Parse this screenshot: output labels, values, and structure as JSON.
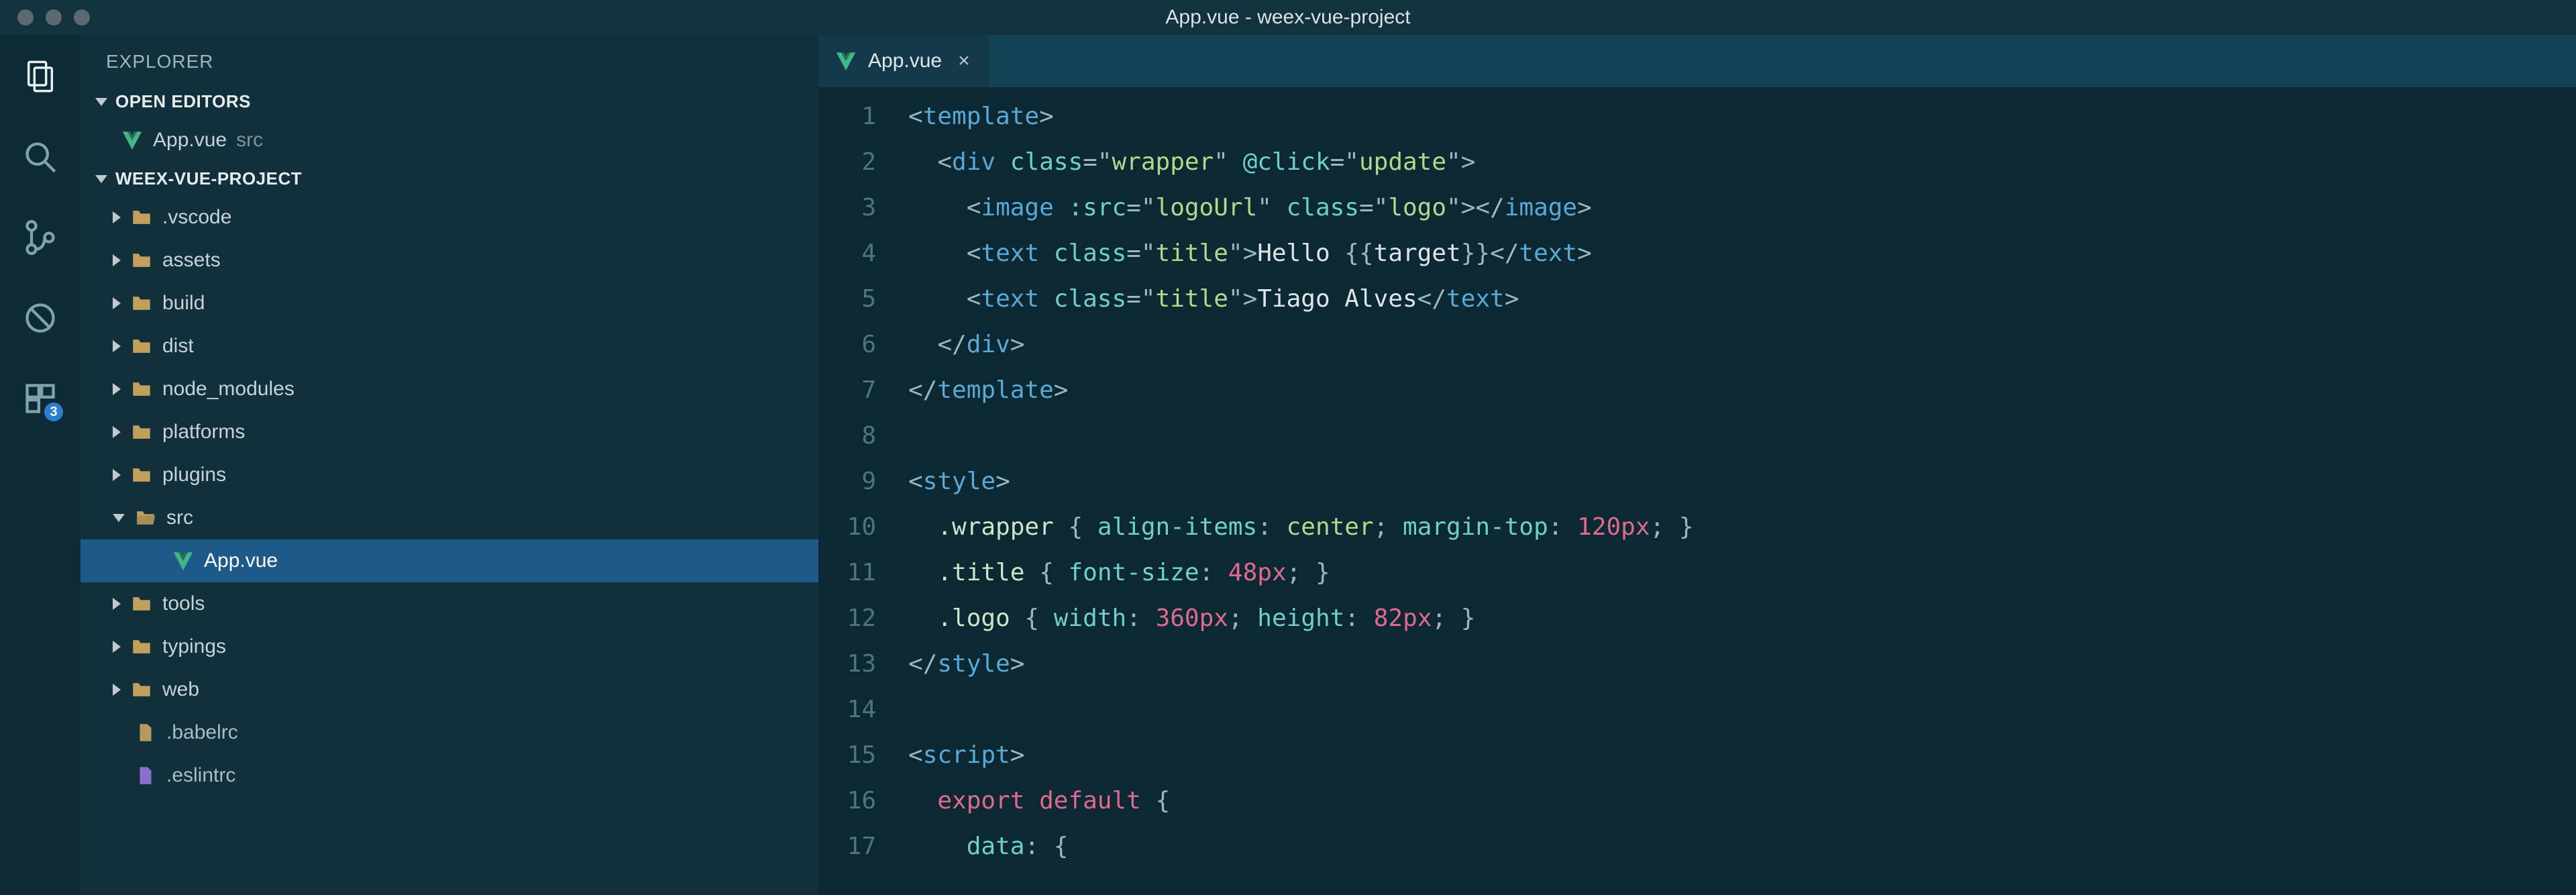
{
  "titlebar": {
    "title": "App.vue - weex-vue-project"
  },
  "activitybar": {
    "debug_badge": "3"
  },
  "sidebar": {
    "title": "EXPLORER",
    "open_editors_label": "OPEN EDITORS",
    "open_editors": [
      {
        "name": "App.vue",
        "path": "src"
      }
    ],
    "project_label": "WEEX-VUE-PROJECT",
    "tree": [
      {
        "kind": "folder",
        "name": ".vscode",
        "depth": 0
      },
      {
        "kind": "folder",
        "name": "assets",
        "depth": 0
      },
      {
        "kind": "folder",
        "name": "build",
        "depth": 0
      },
      {
        "kind": "folder",
        "name": "dist",
        "depth": 0
      },
      {
        "kind": "folder",
        "name": "node_modules",
        "depth": 0
      },
      {
        "kind": "folder",
        "name": "platforms",
        "depth": 0
      },
      {
        "kind": "folder",
        "name": "plugins",
        "depth": 0
      },
      {
        "kind": "folder-open",
        "name": "src",
        "depth": 0
      },
      {
        "kind": "vue",
        "name": "App.vue",
        "depth": 1,
        "selected": true
      },
      {
        "kind": "folder",
        "name": "tools",
        "depth": 0
      },
      {
        "kind": "folder",
        "name": "typings",
        "depth": 0
      },
      {
        "kind": "folder",
        "name": "web",
        "depth": 0
      },
      {
        "kind": "file",
        "name": ".babelrc",
        "depth": 0,
        "noarrow": true
      },
      {
        "kind": "file-purple",
        "name": ".eslintrc",
        "depth": 0,
        "noarrow": true
      }
    ]
  },
  "tab": {
    "name": "App.vue",
    "close": "×"
  },
  "code": {
    "lines": [
      {
        "n": 1,
        "s": [
          [
            "c-punc",
            "<"
          ],
          [
            "c-tag",
            "template"
          ],
          [
            "c-punc",
            ">"
          ]
        ]
      },
      {
        "n": 2,
        "s": [
          [
            "c-text",
            "  "
          ],
          [
            "c-punc",
            "<"
          ],
          [
            "c-tag",
            "div"
          ],
          [
            "c-text",
            " "
          ],
          [
            "c-attr",
            "class"
          ],
          [
            "c-punc",
            "=\""
          ],
          [
            "c-str",
            "wrapper"
          ],
          [
            "c-punc",
            "\" "
          ],
          [
            "c-attr",
            "@click"
          ],
          [
            "c-punc",
            "=\""
          ],
          [
            "c-str",
            "update"
          ],
          [
            "c-punc",
            "\">"
          ]
        ]
      },
      {
        "n": 3,
        "s": [
          [
            "c-text",
            "    "
          ],
          [
            "c-punc",
            "<"
          ],
          [
            "c-tag",
            "image"
          ],
          [
            "c-text",
            " "
          ],
          [
            "c-attr",
            ":src"
          ],
          [
            "c-punc",
            "=\""
          ],
          [
            "c-str",
            "logoUrl"
          ],
          [
            "c-punc",
            "\" "
          ],
          [
            "c-attr",
            "class"
          ],
          [
            "c-punc",
            "=\""
          ],
          [
            "c-str",
            "logo"
          ],
          [
            "c-punc",
            "\"></"
          ],
          [
            "c-tag",
            "image"
          ],
          [
            "c-punc",
            ">"
          ]
        ]
      },
      {
        "n": 4,
        "s": [
          [
            "c-text",
            "    "
          ],
          [
            "c-punc",
            "<"
          ],
          [
            "c-tag",
            "text"
          ],
          [
            "c-text",
            " "
          ],
          [
            "c-attr",
            "class"
          ],
          [
            "c-punc",
            "=\""
          ],
          [
            "c-str",
            "title"
          ],
          [
            "c-punc",
            "\">"
          ],
          [
            "c-text",
            "Hello "
          ],
          [
            "c-punc",
            "{{"
          ],
          [
            "c-text",
            "target"
          ],
          [
            "c-punc",
            "}}"
          ],
          [
            "c-punc",
            "</"
          ],
          [
            "c-tag",
            "text"
          ],
          [
            "c-punc",
            ">"
          ]
        ]
      },
      {
        "n": 5,
        "s": [
          [
            "c-text",
            "    "
          ],
          [
            "c-punc",
            "<"
          ],
          [
            "c-tag",
            "text"
          ],
          [
            "c-text",
            " "
          ],
          [
            "c-attr",
            "class"
          ],
          [
            "c-punc",
            "=\""
          ],
          [
            "c-str",
            "title"
          ],
          [
            "c-punc",
            "\">"
          ],
          [
            "c-text",
            "Tiago Alves"
          ],
          [
            "c-punc",
            "</"
          ],
          [
            "c-tag",
            "text"
          ],
          [
            "c-punc",
            ">"
          ]
        ]
      },
      {
        "n": 6,
        "s": [
          [
            "c-text",
            "  "
          ],
          [
            "c-punc",
            "</"
          ],
          [
            "c-tag",
            "div"
          ],
          [
            "c-punc",
            ">"
          ]
        ]
      },
      {
        "n": 7,
        "s": [
          [
            "c-punc",
            "</"
          ],
          [
            "c-tag",
            "template"
          ],
          [
            "c-punc",
            ">"
          ]
        ]
      },
      {
        "n": 8,
        "s": [
          [
            "c-text",
            " "
          ]
        ]
      },
      {
        "n": 9,
        "s": [
          [
            "c-punc",
            "<"
          ],
          [
            "c-tag",
            "style"
          ],
          [
            "c-punc",
            ">"
          ]
        ]
      },
      {
        "n": 10,
        "s": [
          [
            "c-text",
            "  "
          ],
          [
            "c-sel",
            ".wrapper"
          ],
          [
            "c-text",
            " "
          ],
          [
            "c-punc",
            "{"
          ],
          [
            "c-text",
            " "
          ],
          [
            "c-prop",
            "align-items"
          ],
          [
            "c-punc",
            ":"
          ],
          [
            "c-text",
            " "
          ],
          [
            "c-val",
            "center"
          ],
          [
            "c-punc",
            ";"
          ],
          [
            "c-text",
            " "
          ],
          [
            "c-prop",
            "margin-top"
          ],
          [
            "c-punc",
            ":"
          ],
          [
            "c-text",
            " "
          ],
          [
            "c-num",
            "120px"
          ],
          [
            "c-punc",
            ";"
          ],
          [
            "c-text",
            " "
          ],
          [
            "c-punc",
            "}"
          ]
        ]
      },
      {
        "n": 11,
        "s": [
          [
            "c-text",
            "  "
          ],
          [
            "c-sel",
            ".title"
          ],
          [
            "c-text",
            " "
          ],
          [
            "c-punc",
            "{"
          ],
          [
            "c-text",
            " "
          ],
          [
            "c-prop",
            "font-size"
          ],
          [
            "c-punc",
            ":"
          ],
          [
            "c-text",
            " "
          ],
          [
            "c-num",
            "48px"
          ],
          [
            "c-punc",
            ";"
          ],
          [
            "c-text",
            " "
          ],
          [
            "c-punc",
            "}"
          ]
        ]
      },
      {
        "n": 12,
        "s": [
          [
            "c-text",
            "  "
          ],
          [
            "c-sel",
            ".logo"
          ],
          [
            "c-text",
            " "
          ],
          [
            "c-punc",
            "{"
          ],
          [
            "c-text",
            " "
          ],
          [
            "c-prop",
            "width"
          ],
          [
            "c-punc",
            ":"
          ],
          [
            "c-text",
            " "
          ],
          [
            "c-num",
            "360px"
          ],
          [
            "c-punc",
            ";"
          ],
          [
            "c-text",
            " "
          ],
          [
            "c-prop",
            "height"
          ],
          [
            "c-punc",
            ":"
          ],
          [
            "c-text",
            " "
          ],
          [
            "c-num",
            "82px"
          ],
          [
            "c-punc",
            ";"
          ],
          [
            "c-text",
            " "
          ],
          [
            "c-punc",
            "}"
          ]
        ]
      },
      {
        "n": 13,
        "s": [
          [
            "c-punc",
            "</"
          ],
          [
            "c-tag",
            "style"
          ],
          [
            "c-punc",
            ">"
          ]
        ]
      },
      {
        "n": 14,
        "s": [
          [
            "c-text",
            " "
          ]
        ]
      },
      {
        "n": 15,
        "s": [
          [
            "c-punc",
            "<"
          ],
          [
            "c-tag",
            "script"
          ],
          [
            "c-punc",
            ">"
          ]
        ]
      },
      {
        "n": 16,
        "s": [
          [
            "c-text",
            "  "
          ],
          [
            "c-jskw",
            "export"
          ],
          [
            "c-text",
            " "
          ],
          [
            "c-jskw",
            "default"
          ],
          [
            "c-text",
            " "
          ],
          [
            "c-punc",
            "{"
          ]
        ]
      },
      {
        "n": 17,
        "s": [
          [
            "c-text",
            "    "
          ],
          [
            "c-js",
            "data"
          ],
          [
            "c-punc",
            ":"
          ],
          [
            "c-text",
            " "
          ],
          [
            "c-punc",
            "{"
          ]
        ]
      }
    ]
  }
}
